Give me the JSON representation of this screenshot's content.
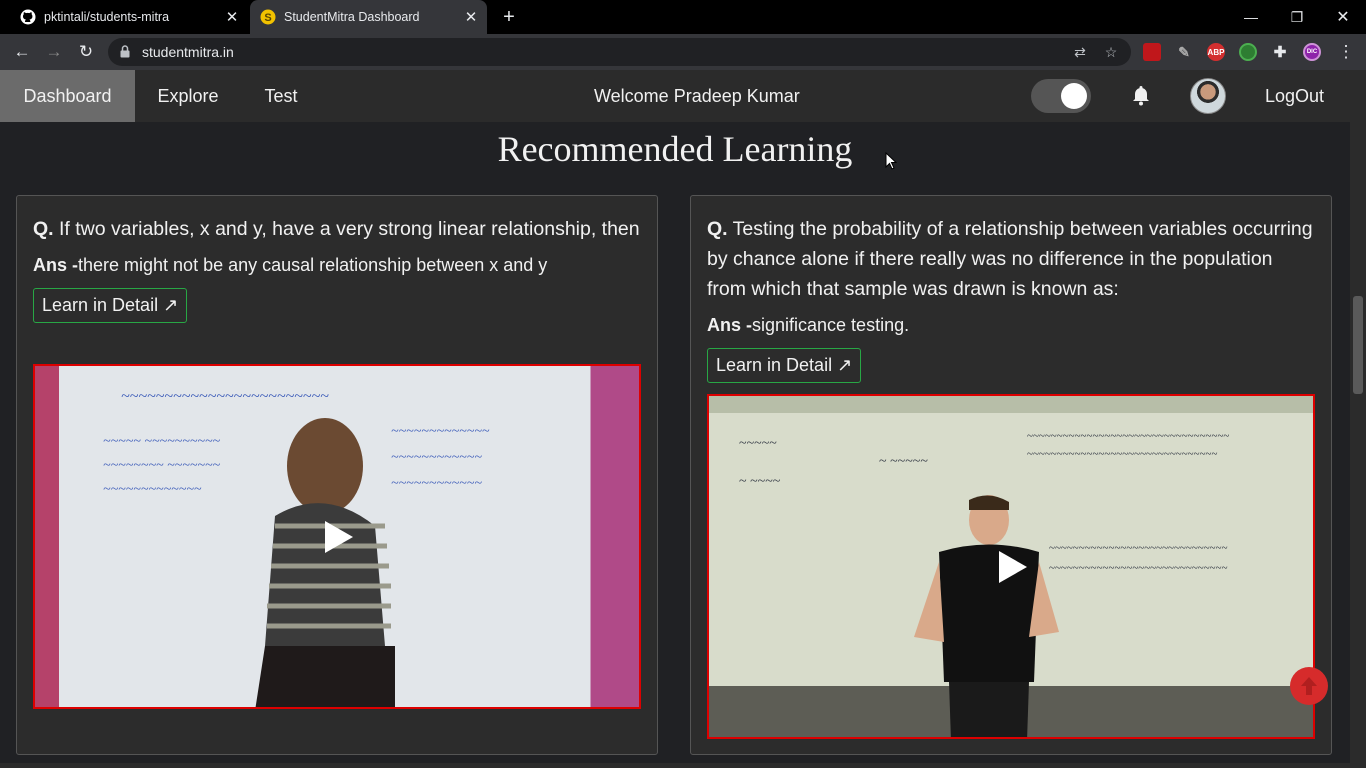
{
  "browser": {
    "tabs": [
      {
        "title": "pktintali/students-mitra",
        "icon": "github-icon"
      },
      {
        "title": "StudentMitra Dashboard",
        "icon": "studentmitra-favicon"
      }
    ],
    "url": "studentmitra.in",
    "extensions": [
      "ublock-icon",
      "pen-icon",
      "abp-icon",
      "target-icon",
      "puzzle-icon",
      "profile-icon"
    ],
    "ext_abp": "ABP",
    "ext_profile": "DIC"
  },
  "navbar": {
    "items": [
      "Dashboard",
      "Explore",
      "Test"
    ],
    "active": "Dashboard",
    "welcome": "Welcome Pradeep Kumar",
    "logout": "LogOut",
    "dark_mode_on": true
  },
  "section": {
    "title": "Recommended Learning"
  },
  "cards": [
    {
      "q_prefix": "Q.",
      "question": "If two variables, x and y, have a very strong linear relationship, then",
      "a_prefix": "Ans -",
      "answer": "there might not be any causal relationship between x and y",
      "learn": "Learn in Detail ↗"
    },
    {
      "q_prefix": "Q.",
      "question": "Testing the probability of a relationship between variables occurring by chance alone if there really was no difference in the population from which that sample was drawn is known as:",
      "a_prefix": "Ans -",
      "answer": "significance testing.",
      "learn": "Learn in Detail ↗"
    }
  ],
  "colors": {
    "accent_border": "#28a745",
    "video_border": "#dd0000",
    "scroll_top": "#d62b2b"
  }
}
